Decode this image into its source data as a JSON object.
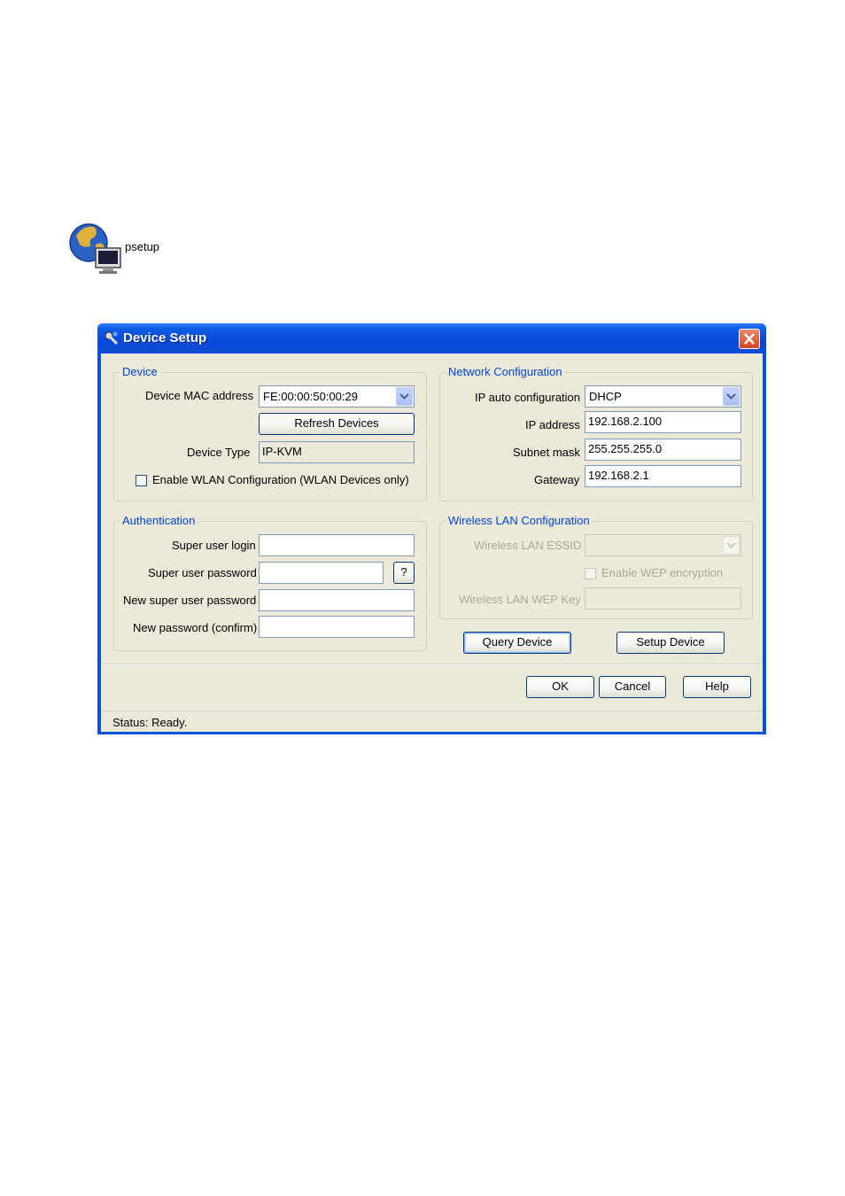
{
  "desktop": {
    "icon_name": "globe-computer-icon",
    "icon_label": "psetup"
  },
  "window": {
    "title": "Device Setup",
    "title_icon": "network-tool-icon",
    "close_icon": "close-icon"
  },
  "device": {
    "legend": "Device",
    "mac_label": "Device MAC address",
    "mac_value": "FE:00:00:50:00:29",
    "refresh_label": "Refresh Devices",
    "type_label": "Device Type",
    "type_value": "IP-KVM",
    "wlan_checkbox_label": "Enable WLAN Configuration (WLAN Devices only)"
  },
  "network": {
    "legend": "Network Configuration",
    "auto_label": "IP auto configuration",
    "auto_value": "DHCP",
    "ip_label": "IP address",
    "ip_value": "192.168.2.100",
    "mask_label": "Subnet mask",
    "mask_value": "255.255.255.0",
    "gateway_label": "Gateway",
    "gateway_value": "192.168.2.1"
  },
  "auth": {
    "legend": "Authentication",
    "login_label": "Super user login",
    "password_label": "Super user password",
    "help_label": "?",
    "new_password_label": "New super user password",
    "confirm_label": "New password (confirm)"
  },
  "wireless": {
    "legend": "Wireless LAN Configuration",
    "essid_label": "Wireless LAN ESSID",
    "wep_checkbox_label": "Enable WEP encryption",
    "wep_key_label": "Wireless LAN WEP Key"
  },
  "actions": {
    "query_label": "Query Device",
    "setup_label": "Setup Device",
    "ok_label": "OK",
    "cancel_label": "Cancel",
    "help_label": "Help"
  },
  "status": {
    "text": "Status: Ready."
  },
  "colors": {
    "titlebar": "#0a52d6",
    "dialog_bg": "#ece9d8",
    "legend_text": "#0046d5",
    "disabled_text": "#aca899"
  }
}
